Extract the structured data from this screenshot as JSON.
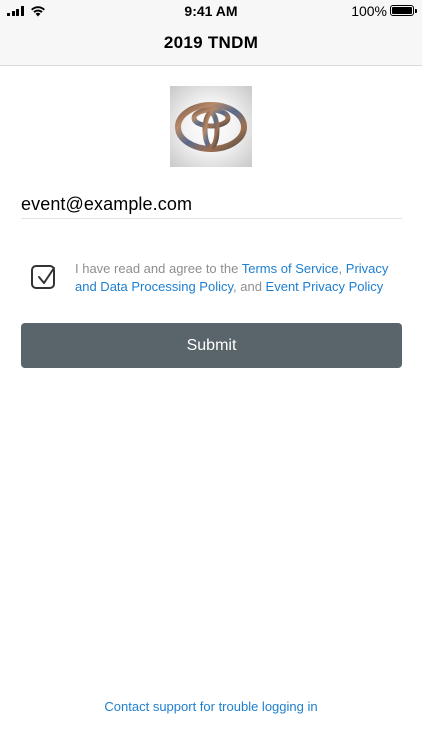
{
  "status_bar": {
    "time": "9:41 AM",
    "battery_percent": "100%",
    "icons": [
      "signal-icon",
      "wifi-icon",
      "battery-icon"
    ]
  },
  "nav": {
    "title": "2019 TNDM"
  },
  "logo": {
    "icon": "toyota-logo-icon"
  },
  "form": {
    "email_value": "event@example.com",
    "agreement": {
      "checked": true,
      "prefix": "I have read and agree to the ",
      "terms_link": "Terms of Service",
      "sep1": ", ",
      "privacy_link": "Privacy and Data Processing Policy",
      "sep2": ", and ",
      "event_link": "Event Privacy Policy"
    },
    "submit_label": "Submit"
  },
  "footer": {
    "support_link": "Contact support for trouble logging in"
  },
  "colors": {
    "link": "#1e7fd0",
    "button_bg": "#59646b",
    "muted_text": "#8e8e8e"
  }
}
